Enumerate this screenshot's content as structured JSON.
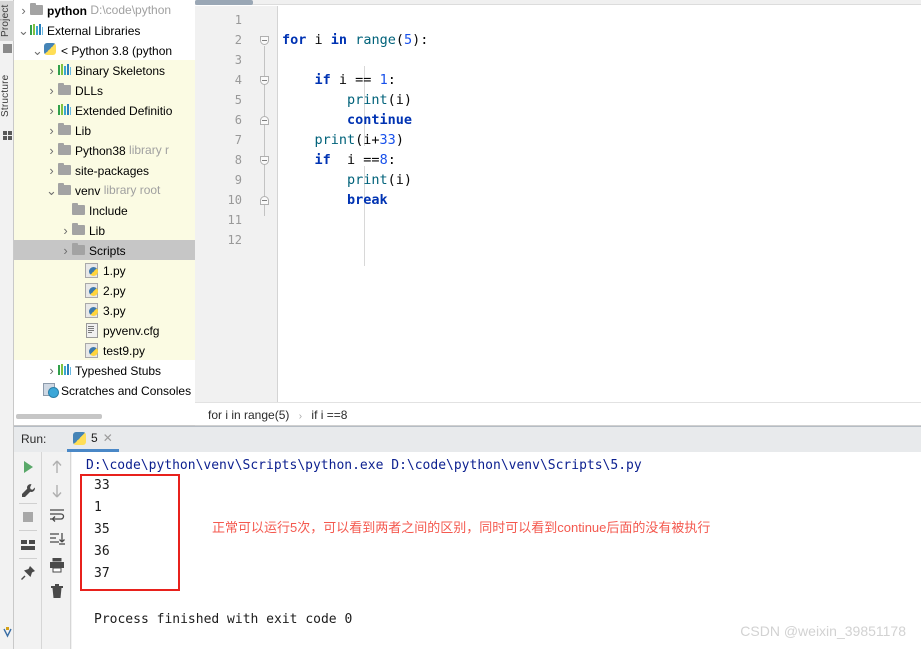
{
  "left_toolbar": {
    "project_tab": "Project",
    "structure_tab": "Structure",
    "project_icon": "project-window-icon",
    "structure_icon": "structure-window-icon",
    "bottom_icon": "vcs-icon"
  },
  "project_tree": {
    "nodes": [
      {
        "label": "python",
        "secondary": "D:\\code\\python",
        "icon": "folder-icon",
        "arrow": "collapsed",
        "indent": 0,
        "bold": true,
        "style": "plain"
      },
      {
        "label": "External Libraries",
        "secondary": "",
        "icon": "library-bars-icon",
        "arrow": "expanded",
        "indent": 0,
        "bold": false,
        "style": "plain"
      },
      {
        "label": "< Python 3.8 (python",
        "secondary": "",
        "icon": "python-interpreter-icon",
        "arrow": "expanded",
        "indent": 1,
        "bold": false,
        "style": "plain"
      },
      {
        "label": "Binary Skeletons",
        "secondary": "",
        "icon": "library-bars-icon",
        "arrow": "collapsed",
        "indent": 2,
        "bold": false,
        "style": "lib"
      },
      {
        "label": "DLLs",
        "secondary": "",
        "icon": "folder-icon",
        "arrow": "collapsed",
        "indent": 2,
        "bold": false,
        "style": "lib"
      },
      {
        "label": "Extended Definitio",
        "secondary": "",
        "icon": "library-bars-icon",
        "arrow": "collapsed",
        "indent": 2,
        "bold": false,
        "style": "lib"
      },
      {
        "label": "Lib",
        "secondary": "",
        "icon": "folder-icon",
        "arrow": "collapsed",
        "indent": 2,
        "bold": false,
        "style": "lib"
      },
      {
        "label": "Python38",
        "secondary": "library r",
        "icon": "folder-icon",
        "arrow": "collapsed",
        "indent": 2,
        "bold": false,
        "style": "lib"
      },
      {
        "label": "site-packages",
        "secondary": "",
        "icon": "folder-icon",
        "arrow": "collapsed",
        "indent": 2,
        "bold": false,
        "style": "lib"
      },
      {
        "label": "venv",
        "secondary": "library root",
        "icon": "folder-icon",
        "arrow": "expanded",
        "indent": 2,
        "bold": false,
        "style": "lib"
      },
      {
        "label": "Include",
        "secondary": "",
        "icon": "folder-icon",
        "arrow": "none",
        "indent": 3,
        "bold": false,
        "style": "lib"
      },
      {
        "label": "Lib",
        "secondary": "",
        "icon": "folder-icon",
        "arrow": "collapsed",
        "indent": 3,
        "bold": false,
        "style": "lib"
      },
      {
        "label": "Scripts",
        "secondary": "",
        "icon": "folder-icon",
        "arrow": "collapsed",
        "indent": 3,
        "bold": false,
        "style": "selected"
      },
      {
        "label": "1.py",
        "secondary": "",
        "icon": "python-file-icon",
        "arrow": "none",
        "indent": 4,
        "bold": false,
        "style": "lib"
      },
      {
        "label": "2.py",
        "secondary": "",
        "icon": "python-file-icon",
        "arrow": "none",
        "indent": 4,
        "bold": false,
        "style": "lib"
      },
      {
        "label": "3.py",
        "secondary": "",
        "icon": "python-file-icon",
        "arrow": "none",
        "indent": 4,
        "bold": false,
        "style": "lib"
      },
      {
        "label": "pyvenv.cfg",
        "secondary": "",
        "icon": "config-file-icon",
        "arrow": "none",
        "indent": 4,
        "bold": false,
        "style": "lib"
      },
      {
        "label": "test9.py",
        "secondary": "",
        "icon": "python-file-icon",
        "arrow": "none",
        "indent": 4,
        "bold": false,
        "style": "lib"
      },
      {
        "label": "Typeshed Stubs",
        "secondary": "",
        "icon": "library-bars-icon",
        "arrow": "collapsed",
        "indent": 2,
        "bold": false,
        "style": "plain"
      },
      {
        "label": "Scratches and Consoles",
        "secondary": "",
        "icon": "scratches-icon",
        "arrow": "none",
        "indent": 1,
        "bold": false,
        "style": "plain"
      }
    ]
  },
  "editor": {
    "line_numbers": [
      "1",
      "2",
      "3",
      "4",
      "5",
      "6",
      "7",
      "8",
      "9",
      "10",
      "11",
      "12"
    ],
    "highlighted_line": 10,
    "lines": [
      {
        "n": 1,
        "text": ""
      },
      {
        "n": 2,
        "text": "for i in range(5):"
      },
      {
        "n": 3,
        "text": ""
      },
      {
        "n": 4,
        "text": "    if i == 1:"
      },
      {
        "n": 5,
        "text": "        print(i)"
      },
      {
        "n": 6,
        "text": "        continue"
      },
      {
        "n": 7,
        "text": "    print(i+33)"
      },
      {
        "n": 8,
        "text": "    if  i ==8:"
      },
      {
        "n": 9,
        "text": "        print(i)"
      },
      {
        "n": 10,
        "text": "        break"
      },
      {
        "n": 11,
        "text": ""
      },
      {
        "n": 12,
        "text": ""
      }
    ]
  },
  "breadcrumb": {
    "items": [
      "for i in range(5)",
      "if i ==8"
    ],
    "separator": "›"
  },
  "run_window": {
    "label": "Run:",
    "tab_name": "5",
    "tab_icon": "python-file-icon",
    "close_icon": "close-icon",
    "toolbar_left": [
      {
        "name": "rerun-button",
        "icon": "run-play-icon"
      },
      {
        "name": "edit-configurations-button",
        "icon": "wrench-icon"
      },
      {
        "name": "stop-button",
        "icon": "stop-square-icon"
      },
      {
        "name": "layout-button",
        "icon": "layout-icon"
      },
      {
        "name": "pin-tab-button",
        "icon": "pin-icon"
      }
    ],
    "toolbar_right": [
      {
        "name": "up-stack-button",
        "icon": "arrow-up-icon"
      },
      {
        "name": "down-stack-button",
        "icon": "arrow-down-icon"
      },
      {
        "name": "soft-wrap-button",
        "icon": "soft-wrap-icon"
      },
      {
        "name": "scroll-to-end-button",
        "icon": "scroll-to-end-icon"
      },
      {
        "name": "print-button",
        "icon": "printer-icon"
      },
      {
        "name": "clear-all-button",
        "icon": "trash-icon"
      }
    ],
    "console": {
      "command": "D:\\code\\python\\venv\\Scripts\\python.exe D:\\code\\python\\venv\\Scripts\\5.py",
      "output": [
        "33",
        "1",
        "35",
        "36",
        "37"
      ],
      "exit_message": "Process finished with exit code 0"
    },
    "annotation": "正常可以运行5次，可以看到两者之间的区别，同时可以看到continue后面的没有被执行",
    "annotation_color": "#f4594f",
    "highlight_box_color": "#e8211c"
  },
  "watermark": "CSDN @weixin_39851178"
}
